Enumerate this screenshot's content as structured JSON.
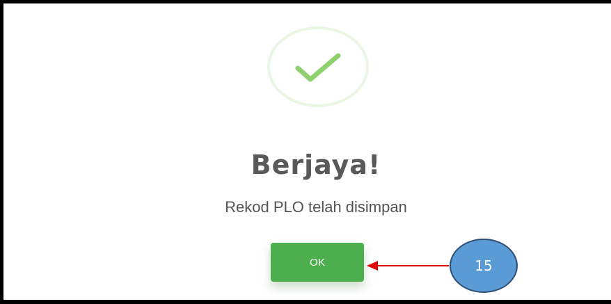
{
  "dialog": {
    "icon": "success-check-icon",
    "title": "Berjaya!",
    "message": "Rekod PLO telah disimpan",
    "ok_label": "OK"
  },
  "annotation": {
    "callout_number": "15"
  },
  "colors": {
    "button_green": "#4cae4c",
    "check_green": "#8fd16f",
    "ring": "#eaf5e3",
    "title_text": "#595959",
    "callout_fill": "#5b9bd5",
    "arrow_red": "#e00000"
  }
}
